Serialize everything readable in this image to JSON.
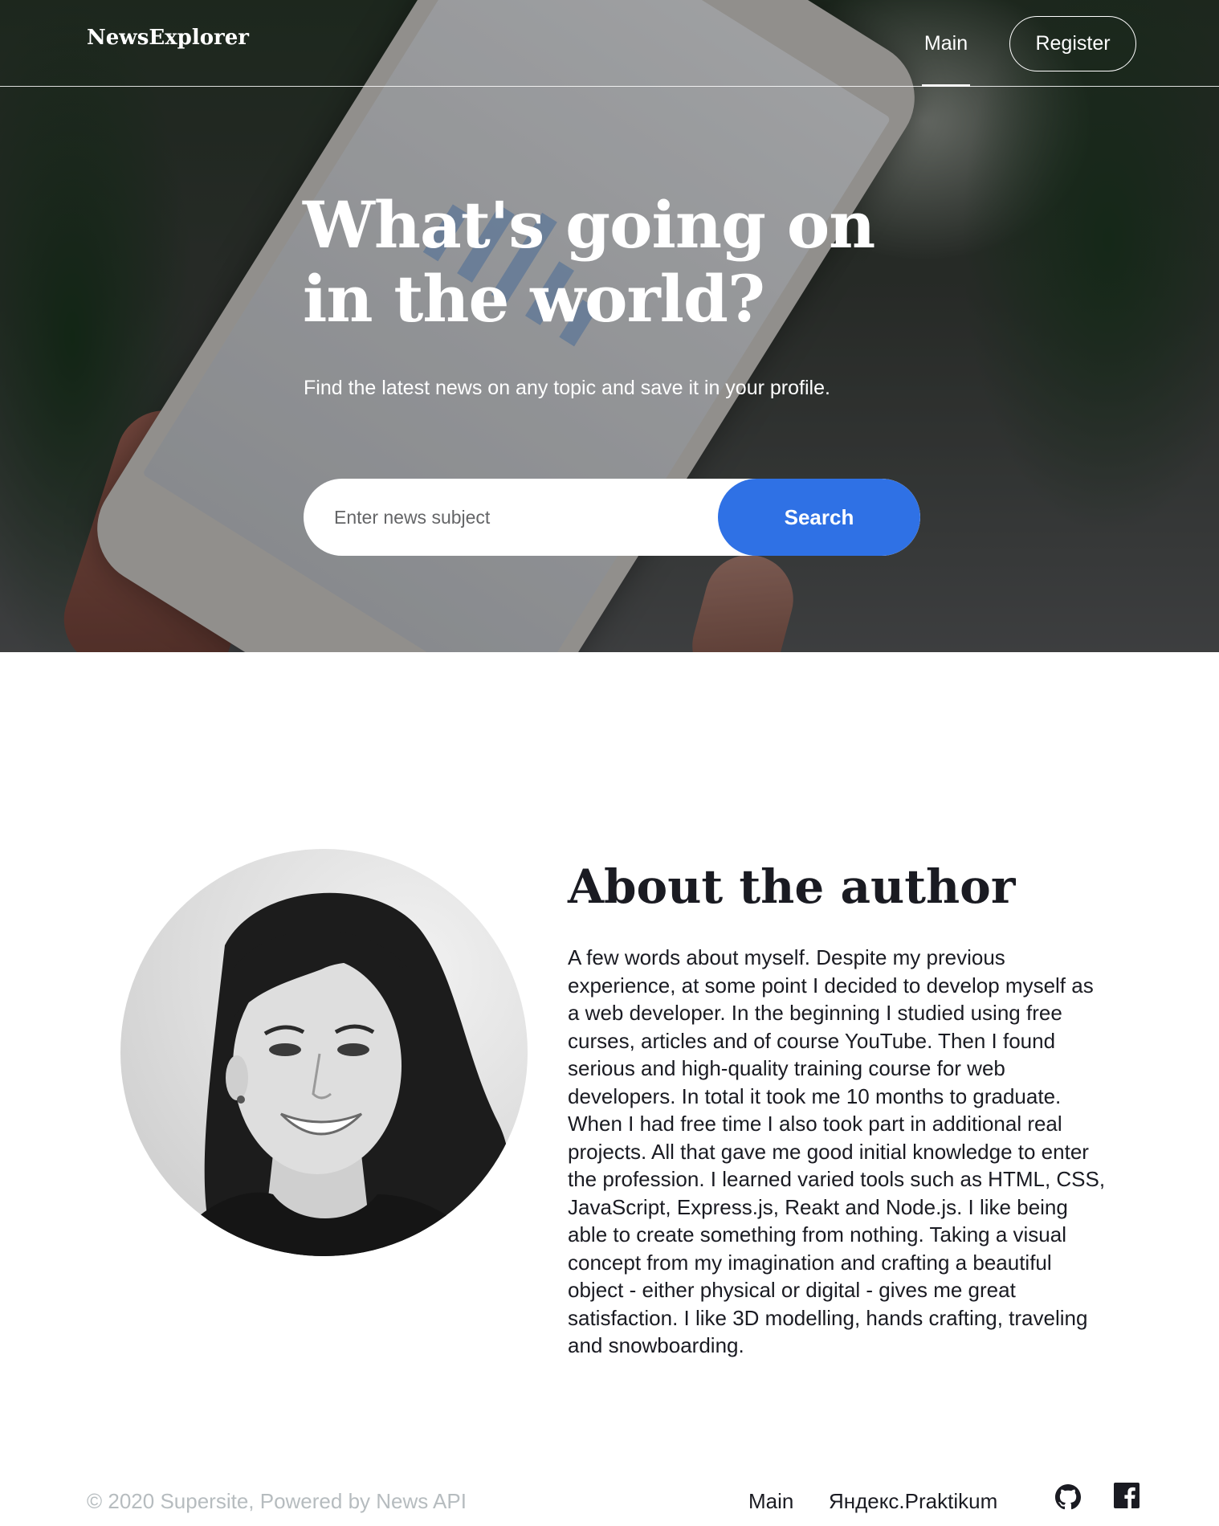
{
  "header": {
    "logo": "NewsExplorer",
    "nav_main": "Main",
    "nav_register": "Register"
  },
  "hero": {
    "title_line1": "What's going on",
    "title_line2": "in the world?",
    "subtitle": "Find the latest news on any topic and save it in your profile.",
    "search": {
      "placeholder": "Enter news subject",
      "button_label": "Search"
    }
  },
  "about": {
    "title": "About the author",
    "text": "A few words about myself. Despite my previous experience, at some point I decided to develop myself as a web developer. In the beginning I studied using free curses, articles and of course YouTube. Then I found serious and high-quality training course for web developers. In total it took me 10 months to graduate. When I had free time I also took part in additional real projects. All that gave me good initial knowledge to enter the profession. I learned varied tools such as HTML, CSS, JavaScript, Express.js, Reakt and Node.js. I like being able to create something from nothing. Taking a visual concept from my imagination and crafting a beautiful object - either physical or digital - gives me great satisfaction. I like 3D modelling, hands crafting, traveling and snowboarding."
  },
  "footer": {
    "copyright": "© 2020 Supersite, Powered by News API",
    "links": {
      "main": "Main",
      "praktikum": "Яндекс.Praktikum"
    },
    "icons": [
      "github-icon",
      "facebook-icon"
    ]
  },
  "colors": {
    "accent": "#2f71e5",
    "text": "#1a1b22",
    "muted": "#b6bcbf"
  }
}
